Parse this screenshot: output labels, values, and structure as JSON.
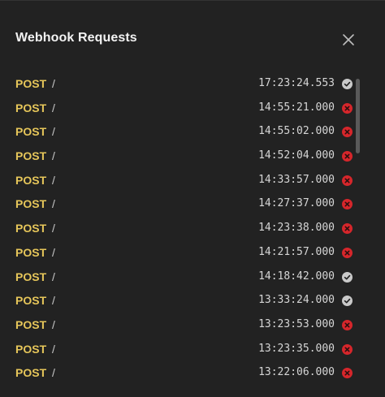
{
  "header": {
    "title": "Webhook Requests",
    "close_icon": "close-icon"
  },
  "colors": {
    "method": "#e6c65a",
    "success": "#c9c9c9",
    "error": "#d6262b"
  },
  "requests": [
    {
      "method": "POST",
      "path": "/",
      "time": "17:23:24.553",
      "status": "success"
    },
    {
      "method": "POST",
      "path": "/",
      "time": "14:55:21.000",
      "status": "error"
    },
    {
      "method": "POST",
      "path": "/",
      "time": "14:55:02.000",
      "status": "error"
    },
    {
      "method": "POST",
      "path": "/",
      "time": "14:52:04.000",
      "status": "error"
    },
    {
      "method": "POST",
      "path": "/",
      "time": "14:33:57.000",
      "status": "error"
    },
    {
      "method": "POST",
      "path": "/",
      "time": "14:27:37.000",
      "status": "error"
    },
    {
      "method": "POST",
      "path": "/",
      "time": "14:23:38.000",
      "status": "error"
    },
    {
      "method": "POST",
      "path": "/",
      "time": "14:21:57.000",
      "status": "error"
    },
    {
      "method": "POST",
      "path": "/",
      "time": "14:18:42.000",
      "status": "success"
    },
    {
      "method": "POST",
      "path": "/",
      "time": "13:33:24.000",
      "status": "success"
    },
    {
      "method": "POST",
      "path": "/",
      "time": "13:23:53.000",
      "status": "error"
    },
    {
      "method": "POST",
      "path": "/",
      "time": "13:23:35.000",
      "status": "error"
    },
    {
      "method": "POST",
      "path": "/",
      "time": "13:22:06.000",
      "status": "error"
    }
  ]
}
